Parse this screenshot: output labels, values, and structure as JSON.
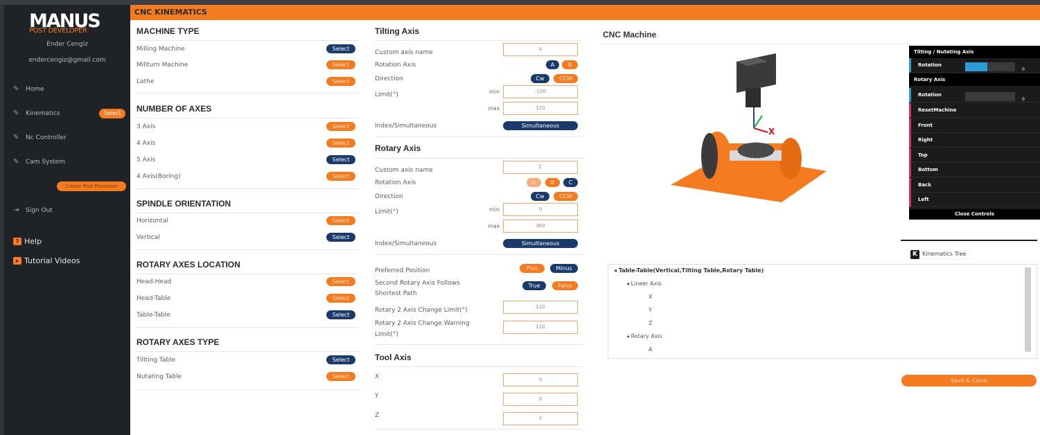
{
  "brand": {
    "logo_main": "MANUS",
    "logo_sub": "POST DEVELOPER",
    "accent": "#f47b20",
    "navy": "#193a6b"
  },
  "user": {
    "name": "Ender Cengiz",
    "email": "endercengiz@gmail.com"
  },
  "nav": {
    "home": "Home",
    "kinematics": "Kinematics",
    "kinematics_badge": "Select",
    "nc": "Nc Controller",
    "cam": "Cam System",
    "create": "Create Post Processor",
    "signout": "Sign Out",
    "help": "Help",
    "tutorials": "Tutorial Videos"
  },
  "page": {
    "title": "CNC KINEMATICS"
  },
  "machine_type": {
    "title": "MACHINE TYPE",
    "items": [
      {
        "label": "Milling Machine",
        "btn": "Select"
      },
      {
        "label": "Millturn Machine",
        "btn": "Select"
      },
      {
        "label": "Lathe",
        "btn": "Select"
      }
    ]
  },
  "num_axes": {
    "title": "NUMBER OF AXES",
    "items": [
      {
        "label": "3 Axis",
        "btn": "Select"
      },
      {
        "label": "4 Axis",
        "btn": "Select"
      },
      {
        "label": "5 Axis",
        "btn": "Select"
      },
      {
        "label": "4 Axis(Boring)",
        "btn": "Select"
      }
    ]
  },
  "spindle": {
    "title": "SPINDLE ORIENTATION",
    "items": [
      {
        "label": "Horizontal",
        "btn": "Select"
      },
      {
        "label": "Vertical",
        "btn": "Select"
      }
    ]
  },
  "rot_loc": {
    "title": "ROTARY AXES LOCATION",
    "items": [
      {
        "label": "Head-Head",
        "btn": "Select"
      },
      {
        "label": "Head-Table",
        "btn": "Select"
      },
      {
        "label": "Table-Table",
        "btn": "Select"
      }
    ]
  },
  "rot_type": {
    "title": "ROTARY AXES TYPE",
    "items": [
      {
        "label": "Tillting Table",
        "btn": "Select"
      },
      {
        "label": "Nutating Table",
        "btn": "Select"
      }
    ]
  },
  "tilting": {
    "title": "Tilting Axis",
    "custom_label": "Custom axis name",
    "custom_value": "A",
    "rotation_label": "Rotation Axis",
    "rot_a": "A",
    "rot_b": "B",
    "direction_label": "Direction",
    "cw": "Cw",
    "ccw": "CCW",
    "limit_label": "Limit(°)",
    "min": "min",
    "max": "max",
    "min_value": "-120",
    "max_value": "120",
    "index_label": "Index/Simultaneous",
    "index_btn": "Simultaneous"
  },
  "rotary": {
    "title": "Rotary Axis",
    "custom_label": "Custom axis name",
    "custom_value": "C",
    "rotation_label": "Rotation Axis",
    "rot_a": "A",
    "rot_b": "B",
    "rot_c": "C",
    "direction_label": "Direction",
    "cw": "Cw",
    "ccw": "CCW",
    "limit_label": "Limit(°)",
    "min": "min",
    "max": "max",
    "min_value": "0",
    "max_value": "360",
    "index_label": "Index/Simultaneous",
    "index_btn": "Simultaneous"
  },
  "prefs": {
    "preferred_label": "Preferred Position",
    "plus": "Plus",
    "minus": "Minus",
    "second_label_1": "Second Rotary Axis Follows",
    "second_label_2": "Shortest Path",
    "true_btn": "True",
    "false_btn": "False",
    "change_limit_label": "Rotary 2 Axis Change Limit(°)",
    "change_limit_value": "120",
    "warning_label_1": "Rotary 2 Axis Change Warning",
    "warning_label_2": "Limit(°)",
    "warning_value": "120"
  },
  "tool": {
    "title": "Tool Axis",
    "x_label": "X",
    "y_label": "Y",
    "z_label": "Z",
    "x_value": "0",
    "y_value": "0",
    "z_value": "1"
  },
  "cnc": {
    "title": "CNC Machine",
    "axis_x": "X"
  },
  "controls": {
    "tilting_header": "Tilting / Nutating Axis",
    "rotation": "Rotation",
    "rotary_header": "Rotary Axis",
    "rotation2": "Rotation",
    "rotation_value": "0",
    "rotation2_value": "0",
    "tilting_level": 0.45,
    "rotary_level": 0.0,
    "views": [
      "ResetMachine",
      "Front",
      "Right",
      "Top",
      "Bottom",
      "Back",
      "Left"
    ],
    "close": "Close Controls"
  },
  "tree": {
    "header": "Kinematics Tree",
    "k": "K",
    "root": "Table-Table(Vertical,Tilting Table,Rotary Table)",
    "linear": "Lineer Axis",
    "x": "X",
    "y": "Y",
    "z": "Z",
    "rotary": "Rotary Axis",
    "a": "A"
  },
  "save": "Save & Close"
}
